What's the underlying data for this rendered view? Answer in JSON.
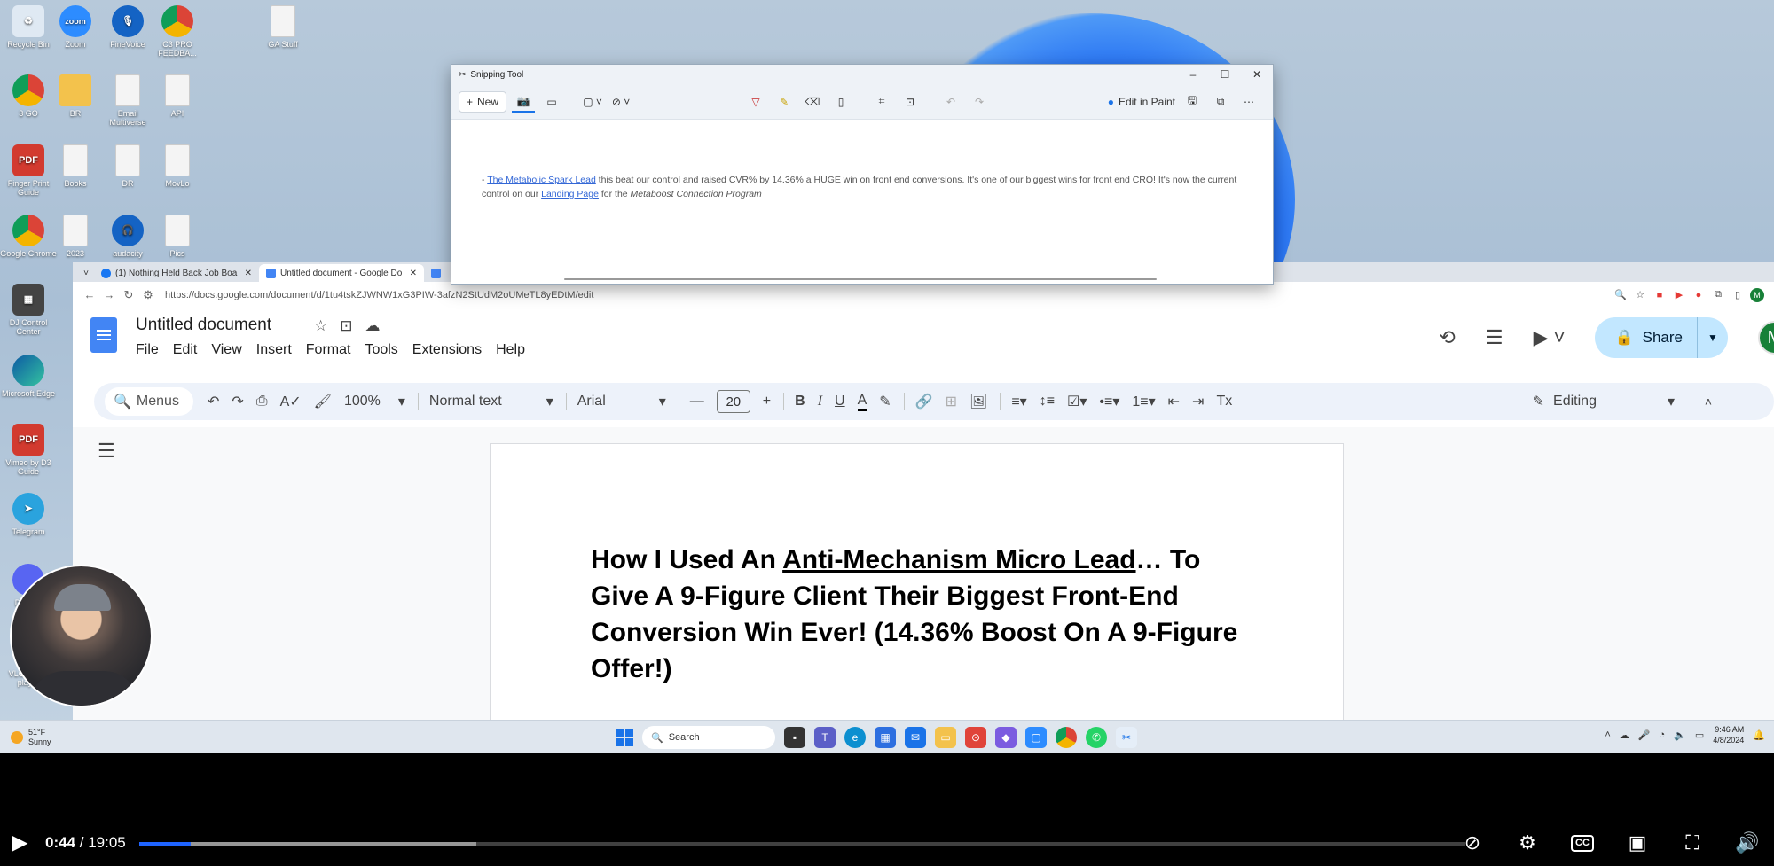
{
  "desktop": {
    "icons": [
      {
        "label": "Recycle Bin",
        "kind": "recycle",
        "glyph": "♻"
      },
      {
        "label": "Zoom",
        "kind": "zoom",
        "glyph": "zoom"
      },
      {
        "label": "FineVoice",
        "kind": "aud",
        "glyph": "🎙"
      },
      {
        "label": "C3 PRO FEEDBA...",
        "kind": "chrome",
        "glyph": ""
      },
      {
        "label": "GA Stuff",
        "kind": "doc",
        "glyph": ""
      },
      {
        "label": "3 GO",
        "kind": "chrome",
        "glyph": ""
      },
      {
        "label": "BR",
        "kind": "folder",
        "glyph": ""
      },
      {
        "label": "Email Multiverse",
        "kind": "doc",
        "glyph": ""
      },
      {
        "label": "API",
        "kind": "doc",
        "glyph": ""
      },
      {
        "label": "Finger Print Guide",
        "kind": "pdf",
        "glyph": "PDF"
      },
      {
        "label": "Books",
        "kind": "doc",
        "glyph": ""
      },
      {
        "label": "DR",
        "kind": "doc",
        "glyph": ""
      },
      {
        "label": "MovLo",
        "kind": "doc",
        "glyph": ""
      },
      {
        "label": "Google Chrome",
        "kind": "chrome",
        "glyph": ""
      },
      {
        "label": "2023",
        "kind": "doc",
        "glyph": ""
      },
      {
        "label": "audacity",
        "kind": "aud",
        "glyph": "🎧"
      },
      {
        "label": "Pics",
        "kind": "doc",
        "glyph": ""
      },
      {
        "label": "DJ Control Center",
        "kind": "control",
        "glyph": "▦"
      },
      {
        "label": "Microsoft Edge",
        "kind": "edge",
        "glyph": ""
      },
      {
        "label": "Vimeo by D3 Guide",
        "kind": "pdf",
        "glyph": "PDF"
      },
      {
        "label": "Telegram",
        "kind": "tg",
        "glyph": "➤"
      },
      {
        "label": "Discord",
        "kind": "disc",
        "glyph": ""
      },
      {
        "label": "VLC media player",
        "kind": "doc",
        "glyph": ""
      }
    ]
  },
  "snipping_tool": {
    "title": "Snipping Tool",
    "new_label": "New",
    "edit_in_paint": "Edit in Paint",
    "snip_prefix": "- ",
    "link1": "The Metabolic Spark Lead",
    "text1": " this beat our control and raised CVR% by 14.36% a HUGE win on front end conversions. It's one of our biggest wins for front end CRO! It's now the current control on our ",
    "link2": "Landing Page",
    "text2": " for the ",
    "italic": "Metaboost Connection Program"
  },
  "browser": {
    "tabs": [
      {
        "label": "(1) Nothing Held Back Job Boa",
        "color": "#1877f2"
      },
      {
        "label": "Untitled document - Google Do",
        "color": "#4285f4"
      }
    ],
    "url": "https://docs.google.com/document/d/1tu4tskZJWNW1xG3PIW-3afzN2StUdM2oUMeTL8yEDtM/edit",
    "account_initial": "M"
  },
  "docs": {
    "title": "Untitled document",
    "menu": [
      "File",
      "Edit",
      "View",
      "Insert",
      "Format",
      "Tools",
      "Extensions",
      "Help"
    ],
    "share_label": "Share",
    "menus_placeholder": "Menus",
    "zoom": "100%",
    "style": "Normal text",
    "font": "Arial",
    "font_size": "20",
    "mode": "Editing",
    "heading_part1": "How I Used An ",
    "heading_link": "Anti-Mechanism Micro Lead",
    "heading_part2": "… To Give A 9-Figure Client Their Biggest Front-End Conversion Win Ever! (14.36% Boost On A 9-Figure Offer!)"
  },
  "taskbar": {
    "weather_temp": "51°F",
    "weather_desc": "Sunny",
    "search_label": "Search",
    "time": "9:46 AM",
    "date": "4/8/2024"
  },
  "player": {
    "current": "0:44",
    "separator": " / ",
    "duration": "19:05",
    "played_fraction": 0.0385,
    "buffered_fraction": 0.2545,
    "cc_label": "CC"
  }
}
